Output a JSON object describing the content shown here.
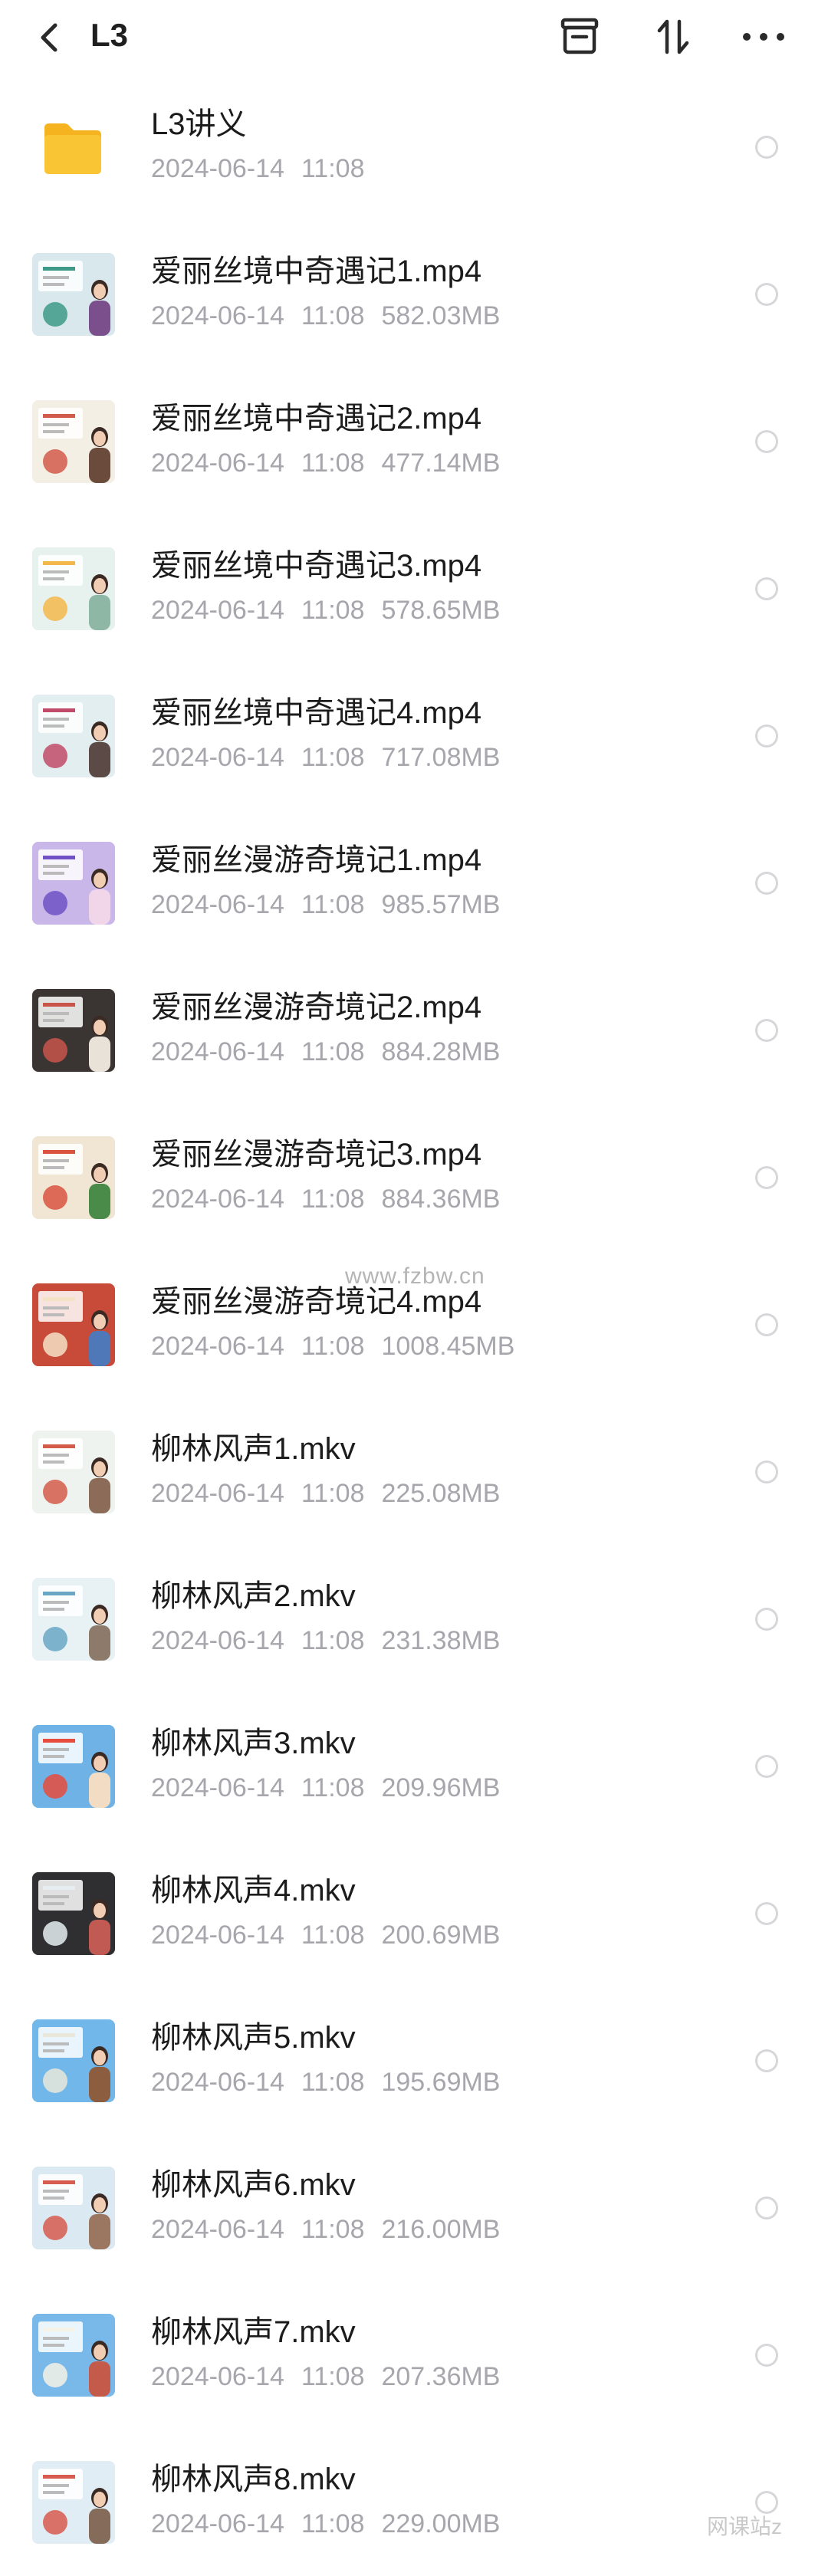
{
  "header": {
    "title": "L3",
    "back_icon": "chevron-left-icon",
    "actions": [
      {
        "name": "archive-button",
        "icon": "archive-icon"
      },
      {
        "name": "sort-button",
        "icon": "sort-icon"
      },
      {
        "name": "more-button",
        "icon": "more-horizontal-icon"
      }
    ]
  },
  "files": [
    {
      "name": "L3讲义",
      "date": "2024-06-14",
      "time": "11:08",
      "size": "",
      "type": "folder"
    },
    {
      "name": "爱丽丝境中奇遇记1.mp4",
      "date": "2024-06-14",
      "time": "11:08",
      "size": "582.03MB",
      "type": "video",
      "thumb": [
        "#d8e8ec",
        "#3e9a88",
        "#7a4f8c"
      ]
    },
    {
      "name": "爱丽丝境中奇遇记2.mp4",
      "date": "2024-06-14",
      "time": "11:08",
      "size": "477.14MB",
      "type": "video",
      "thumb": [
        "#f3efe4",
        "#d25a4a",
        "#6a4b3c"
      ]
    },
    {
      "name": "爱丽丝境中奇遇记3.mp4",
      "date": "2024-06-14",
      "time": "11:08",
      "size": "578.65MB",
      "type": "video",
      "thumb": [
        "#e7f1ee",
        "#f2b84a",
        "#8fb7a6"
      ]
    },
    {
      "name": "爱丽丝境中奇遇记4.mp4",
      "date": "2024-06-14",
      "time": "11:08",
      "size": "717.08MB",
      "type": "video",
      "thumb": [
        "#e3eef0",
        "#c14a68",
        "#5b4a45"
      ]
    },
    {
      "name": "爱丽丝漫游奇境记1.mp4",
      "date": "2024-06-14",
      "time": "11:08",
      "size": "985.57MB",
      "type": "video",
      "thumb": [
        "#c8b7e8",
        "#7052c6",
        "#f0d6e8"
      ]
    },
    {
      "name": "爱丽丝漫游奇境记2.mp4",
      "date": "2024-06-14",
      "time": "11:08",
      "size": "884.28MB",
      "type": "video",
      "thumb": [
        "#3a3532",
        "#c8544a",
        "#e8e2d8"
      ]
    },
    {
      "name": "爱丽丝漫游奇境记3.mp4",
      "date": "2024-06-14",
      "time": "11:08",
      "size": "884.36MB",
      "type": "video",
      "thumb": [
        "#f1e6d4",
        "#d9533f",
        "#4a8b4a"
      ]
    },
    {
      "name": "爱丽丝漫游奇境记4.mp4",
      "date": "2024-06-14",
      "time": "11:08",
      "size": "1008.45MB",
      "type": "video",
      "thumb": [
        "#c84a38",
        "#f4e2c6",
        "#4f78b8"
      ]
    },
    {
      "name": "柳林风声1.mkv",
      "date": "2024-06-14",
      "time": "11:08",
      "size": "225.08MB",
      "type": "video",
      "thumb": [
        "#eef3ef",
        "#d45a4a",
        "#8c6b58"
      ]
    },
    {
      "name": "柳林风声2.mkv",
      "date": "2024-06-14",
      "time": "11:08",
      "size": "231.38MB",
      "type": "video",
      "thumb": [
        "#e8f2f4",
        "#6aa7c4",
        "#8d7a6a"
      ]
    },
    {
      "name": "柳林风声3.mkv",
      "date": "2024-06-14",
      "time": "11:08",
      "size": "209.96MB",
      "type": "video",
      "thumb": [
        "#6fb2e6",
        "#e74c3c",
        "#f3dcc4"
      ]
    },
    {
      "name": "柳林风声4.mkv",
      "date": "2024-06-14",
      "time": "11:08",
      "size": "200.69MB",
      "type": "video",
      "thumb": [
        "#2f2f31",
        "#e6eef2",
        "#c05a52"
      ]
    },
    {
      "name": "柳林风声5.mkv",
      "date": "2024-06-14",
      "time": "11:08",
      "size": "195.69MB",
      "type": "video",
      "thumb": [
        "#72b7ea",
        "#e8e7d9",
        "#8c5d3e"
      ]
    },
    {
      "name": "柳林风声6.mkv",
      "date": "2024-06-14",
      "time": "11:08",
      "size": "216.00MB",
      "type": "video",
      "thumb": [
        "#dbe9f2",
        "#d65c4f",
        "#9b7762"
      ]
    },
    {
      "name": "柳林风声7.mkv",
      "date": "2024-06-14",
      "time": "11:08",
      "size": "207.36MB",
      "type": "video",
      "thumb": [
        "#78b9ea",
        "#f5f2e8",
        "#c45b4a"
      ]
    },
    {
      "name": "柳林风声8.mkv",
      "date": "2024-06-14",
      "time": "11:08",
      "size": "229.00MB",
      "type": "video",
      "thumb": [
        "#e1edf5",
        "#d85a50",
        "#846b5a"
      ]
    }
  ],
  "watermark": "www.fzbw.cn",
  "corner_watermark": "网课站z",
  "colors": {
    "folder": "#f9c534",
    "meta_text": "#a6a6ad",
    "radio_border": "#d7d7da"
  }
}
